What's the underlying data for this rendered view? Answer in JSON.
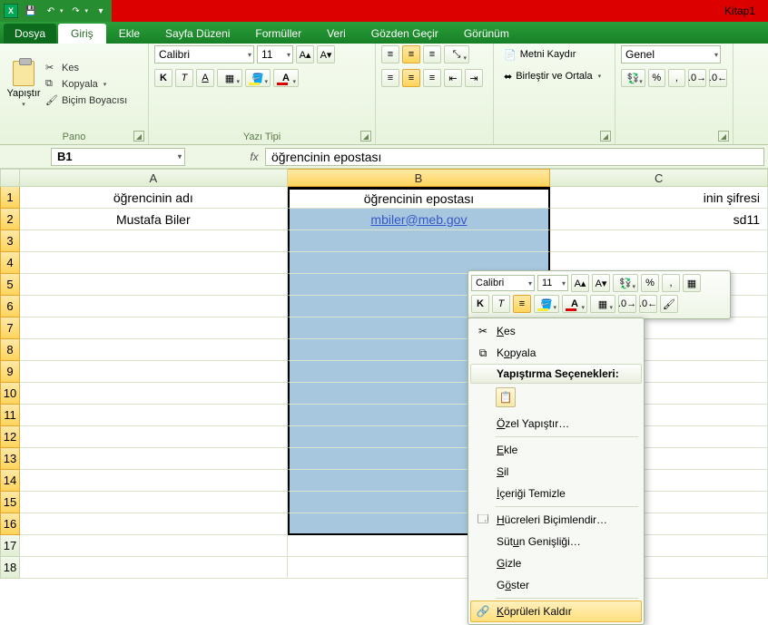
{
  "titlebar": {
    "filename": "Kitap1"
  },
  "tabs": {
    "file": "Dosya",
    "items": [
      "Giriş",
      "Ekle",
      "Sayfa Düzeni",
      "Formüller",
      "Veri",
      "Gözden Geçir",
      "Görünüm"
    ],
    "active": 0
  },
  "ribbon": {
    "pano": {
      "label": "Pano",
      "paste": "Yapıştır",
      "cut": "Kes",
      "copy": "Kopyala",
      "fmt": "Biçim Boyacısı"
    },
    "font": {
      "label": "Yazı Tipi",
      "name": "Calibri",
      "size": "11"
    },
    "wrap": {
      "wrapText": "Metni Kaydır",
      "merge": "Birleştir ve Ortala"
    },
    "number": {
      "label": "Genel"
    }
  },
  "formula": {
    "name": "B1",
    "value": "öğrencinin epostası"
  },
  "columns": {
    "A": "A",
    "B": "B",
    "C": "C"
  },
  "data": {
    "A1": "öğrencinin adı",
    "B1": "öğrencinin epostası",
    "C1": "inin şifresi",
    "A2": "Mustafa Biler",
    "B2": "mbiler@meb.gov",
    "C2": "sd11"
  },
  "mini": {
    "font": "Calibri",
    "size": "11"
  },
  "context": {
    "cut": "Kes",
    "copy": "Kopyala",
    "pasteHdr": "Yapıştırma Seçenekleri:",
    "pasteSpecial": "Özel Yapıştır…",
    "insert": "Ekle",
    "delete": "Sil",
    "clear": "İçeriği Temizle",
    "formatCells": "Hücreleri Biçimlendir…",
    "colWidth": "Sütun Genişliği…",
    "hide": "Gizle",
    "show": "Göster",
    "removeLinks": "Köprüleri Kaldır"
  }
}
